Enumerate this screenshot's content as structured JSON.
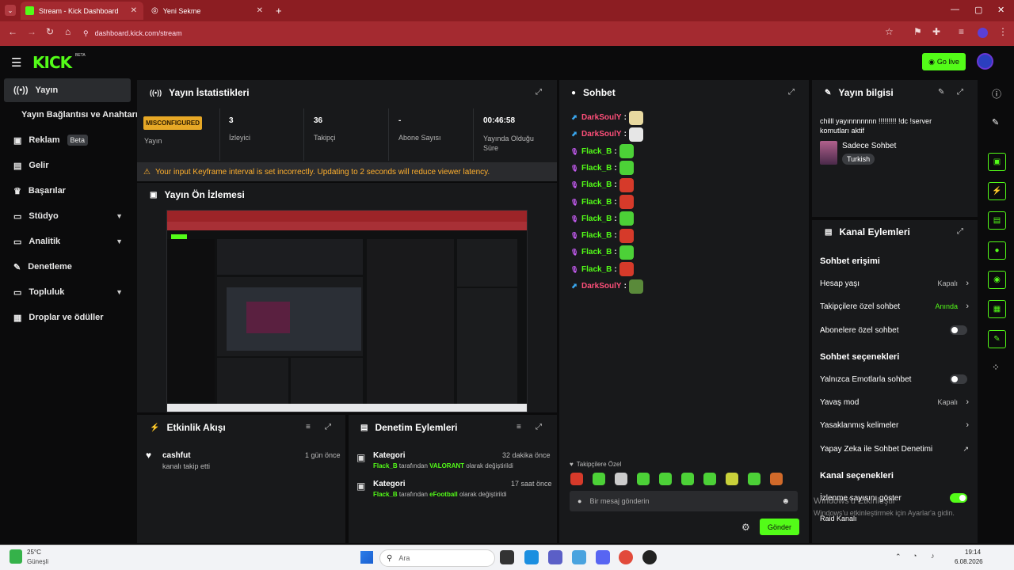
{
  "browser": {
    "tabs": [
      {
        "label": "Stream - Kick Dashboard",
        "active": true
      },
      {
        "label": "Yeni Sekme",
        "active": false
      }
    ],
    "url": "dashboard.kick.com/stream"
  },
  "header": {
    "logo": "KICK",
    "logo_sup": "BETA",
    "go_live": "Go live"
  },
  "sidebar": {
    "items": [
      {
        "label": "Yayın",
        "icon": "broadcast-icon"
      },
      {
        "label": "Yayın Bağlantısı ve Anahtarı",
        "icon": ""
      },
      {
        "label": "Reklam",
        "icon": "ad-icon",
        "badge": "Beta"
      },
      {
        "label": "Gelir",
        "icon": "chart-icon"
      },
      {
        "label": "Başarılar",
        "icon": "trophy-icon"
      },
      {
        "label": "Stüdyo",
        "icon": "studio-icon",
        "expandable": true
      },
      {
        "label": "Analitik",
        "icon": "analytics-icon",
        "expandable": true
      },
      {
        "label": "Denetleme",
        "icon": "wrench-icon"
      },
      {
        "label": "Topluluk",
        "icon": "community-icon",
        "expandable": true
      },
      {
        "label": "Droplar ve ödüller",
        "icon": "drops-icon"
      }
    ]
  },
  "stats": {
    "title": "Yayın İstatistikleri",
    "status_badge": "MISCONFIGURED",
    "status_label": "Yayın",
    "items": [
      {
        "value": "3",
        "label": "İzleyici"
      },
      {
        "value": "36",
        "label": "Takipçi"
      },
      {
        "value": "-",
        "label": "Abone Sayısı"
      },
      {
        "value": "00:46:58",
        "label": "Yayında Olduğu Süre"
      }
    ],
    "warning": "Your input Keyframe interval is set incorrectly. Updating to 2 seconds will reduce viewer latency."
  },
  "preview": {
    "title": "Yayın Ön İzlemesi"
  },
  "activity": {
    "title": "Etkinlik Akışı",
    "items": [
      {
        "user": "cashfut",
        "text": "kanalı takip etti",
        "time": "1 gün önce"
      }
    ]
  },
  "moderation": {
    "title": "Denetim Eylemleri",
    "items": [
      {
        "title": "Kategori",
        "time": "32 dakika önce",
        "actor": "Flack_B",
        "mid": " tarafından ",
        "value": "VALORANT",
        "tail": " olarak değiştirildi"
      },
      {
        "title": "Kategori",
        "time": "17 saat önce",
        "actor": "Flack_B",
        "mid": " tarafından ",
        "value": "eFootball",
        "tail": " olarak değiştirildi"
      }
    ]
  },
  "chat": {
    "title": "Sohbet",
    "messages": [
      {
        "user": "DarkSoulY",
        "color": "#ff4f7a",
        "badge": "broadcaster",
        "emote": "#e8d9a0"
      },
      {
        "user": "DarkSoulY",
        "color": "#ff4f7a",
        "badge": "broadcaster",
        "emote": "#e6e6e6"
      },
      {
        "user": "Flack_B",
        "color": "#53fc18",
        "badge": "mic",
        "emote": "#4cd137"
      },
      {
        "user": "Flack_B",
        "color": "#53fc18",
        "badge": "mic",
        "emote": "#4cd137"
      },
      {
        "user": "Flack_B",
        "color": "#53fc18",
        "badge": "mic",
        "emote": "#d63a2a"
      },
      {
        "user": "Flack_B",
        "color": "#53fc18",
        "badge": "mic",
        "emote": "#d63a2a"
      },
      {
        "user": "Flack_B",
        "color": "#53fc18",
        "badge": "mic",
        "emote": "#4cd137"
      },
      {
        "user": "Flack_B",
        "color": "#53fc18",
        "badge": "mic",
        "emote": "#d63a2a"
      },
      {
        "user": "Flack_B",
        "color": "#53fc18",
        "badge": "mic",
        "emote": "#4cd137"
      },
      {
        "user": "Flack_B",
        "color": "#53fc18",
        "badge": "mic",
        "emote": "#d63a2a"
      },
      {
        "user": "DarkSoulY",
        "color": "#ff4f7a",
        "badge": "broadcaster",
        "emote": "#5a8a3a"
      }
    ],
    "followers_only": "Takipçilere Özel",
    "emote_bar": [
      "#d63a2a",
      "#4cd137",
      "#cccccc",
      "#4cd137",
      "#4cd137",
      "#4cd137",
      "#4cd137",
      "#c9d13a",
      "#4cd137",
      "#d16a2a"
    ],
    "input_placeholder": "Bir mesaj gönderin",
    "send": "Gönder"
  },
  "stream_info": {
    "title": "Yayın bilgisi",
    "stream_title": "chilll yayınnnnnnn !!!!!!!!! !dc !server komutları aktif",
    "category": "Sadece Sohbet",
    "language": "Turkish"
  },
  "channel_actions": {
    "title": "Kanal Eylemleri",
    "sections": [
      {
        "heading": "Sohbet erişimi",
        "rows": [
          {
            "label": "Hesap yaşı",
            "value": "Kapalı",
            "type": "arrow"
          },
          {
            "label": "Takipçilere özel sohbet",
            "value": "Anında",
            "type": "arrow",
            "accent": true
          },
          {
            "label": "Abonelere özel sohbet",
            "type": "toggle",
            "on": false
          }
        ]
      },
      {
        "heading": "Sohbet seçenekleri",
        "rows": [
          {
            "label": "Yalnızca Emotlarla sohbet",
            "type": "toggle",
            "on": false
          },
          {
            "label": "Yavaş mod",
            "value": "Kapalı",
            "type": "arrow"
          },
          {
            "label": "Yasaklanmış kelimeler",
            "type": "arrow"
          },
          {
            "label": "Yapay Zeka ile Sohbet Denetimi",
            "type": "external"
          }
        ]
      },
      {
        "heading": "Kanal seçenekleri",
        "rows": [
          {
            "label": "İzlenme sayısını göster",
            "type": "toggle",
            "on": true
          },
          {
            "label": "Raid Kanalı",
            "type": "none"
          }
        ]
      }
    ]
  },
  "watermark": {
    "line1": "Windows'u Etkinleştir",
    "line2": "Windows'u etkinleştirmek için Ayarlar'a gidin."
  },
  "taskbar": {
    "temp": "25°C",
    "weather": "Güneşli",
    "search": "Ara",
    "time": "19:14",
    "date": "6.08.2026"
  }
}
